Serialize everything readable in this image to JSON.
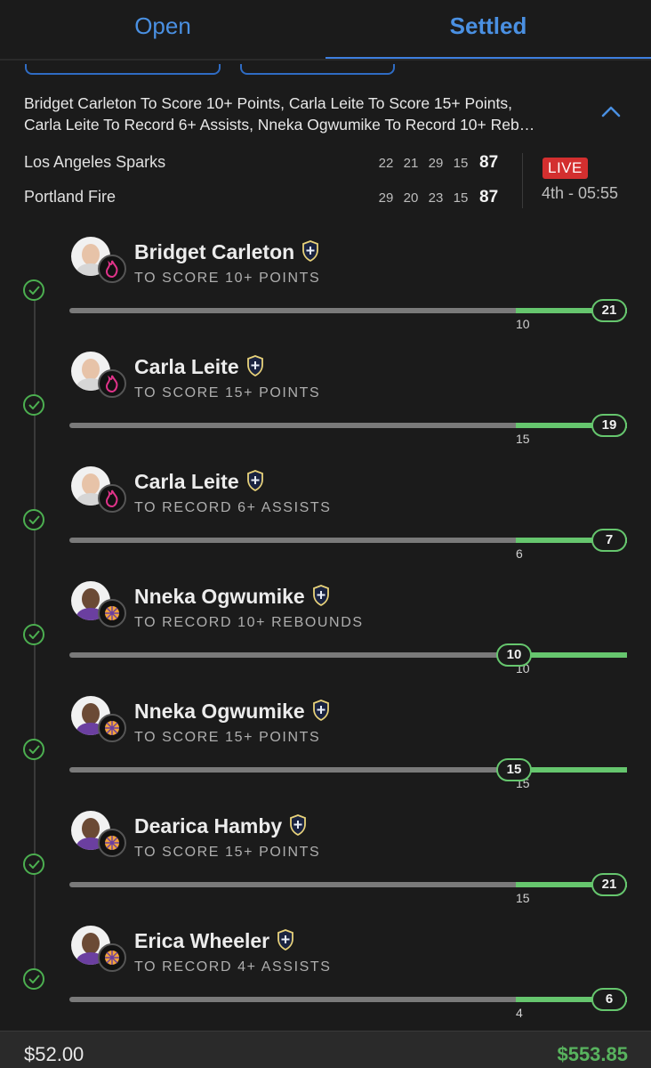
{
  "tabs": [
    {
      "label": "Open",
      "active": false
    },
    {
      "label": "Settled",
      "active": true
    }
  ],
  "bet": {
    "description_line1": "Bridget Carleton To Score 10+ Points, Carla Leite To Score 15+ Points,",
    "description_line2": "Carla Leite To Record 6+ Assists, Nneka Ogwumike To Record 10+ Reb…",
    "expand_icon": "chevron-up-icon"
  },
  "game": {
    "teams": [
      {
        "name": "Los Angeles Sparks",
        "quarters": [
          "22",
          "21",
          "29",
          "15"
        ],
        "total": "87"
      },
      {
        "name": "Portland Fire",
        "quarters": [
          "29",
          "20",
          "23",
          "15"
        ],
        "total": "87"
      }
    ],
    "status_badge": "LIVE",
    "clock": "4th - 05:55"
  },
  "legs": [
    {
      "player": "Bridget Carleton",
      "market": "TO SCORE 10+ POINTS",
      "threshold": "10",
      "current": "21",
      "progress_pct": 100,
      "team": "fire",
      "status": "won"
    },
    {
      "player": "Carla Leite",
      "market": "TO SCORE 15+ POINTS",
      "threshold": "15",
      "current": "19",
      "progress_pct": 100,
      "team": "fire",
      "status": "won"
    },
    {
      "player": "Carla Leite",
      "market": "TO RECORD 6+ ASSISTS",
      "threshold": "6",
      "current": "7",
      "progress_pct": 100,
      "team": "fire",
      "status": "won"
    },
    {
      "player": "Nneka Ogwumike",
      "market": "TO RECORD 10+ REBOUNDS",
      "threshold": "10",
      "current": "10",
      "progress_pct": 100,
      "team": "sparks",
      "status": "won"
    },
    {
      "player": "Nneka Ogwumike",
      "market": "TO SCORE 15+ POINTS",
      "threshold": "15",
      "current": "15",
      "progress_pct": 100,
      "team": "sparks",
      "status": "won"
    },
    {
      "player": "Dearica Hamby",
      "market": "TO SCORE 15+ POINTS",
      "threshold": "15",
      "current": "21",
      "progress_pct": 100,
      "team": "sparks",
      "status": "won"
    },
    {
      "player": "Erica Wheeler",
      "market": "TO RECORD 4+ ASSISTS",
      "threshold": "4",
      "current": "6",
      "progress_pct": 100,
      "team": "sparks",
      "status": "won"
    }
  ],
  "footer": {
    "stake": "$52.00",
    "payout": "$553.85"
  },
  "colors": {
    "accent": "#4a90e2",
    "win": "#66c66e",
    "live": "#d32f2f",
    "fire_team": "#e0338a",
    "sparks_team": "#f2a33a"
  }
}
